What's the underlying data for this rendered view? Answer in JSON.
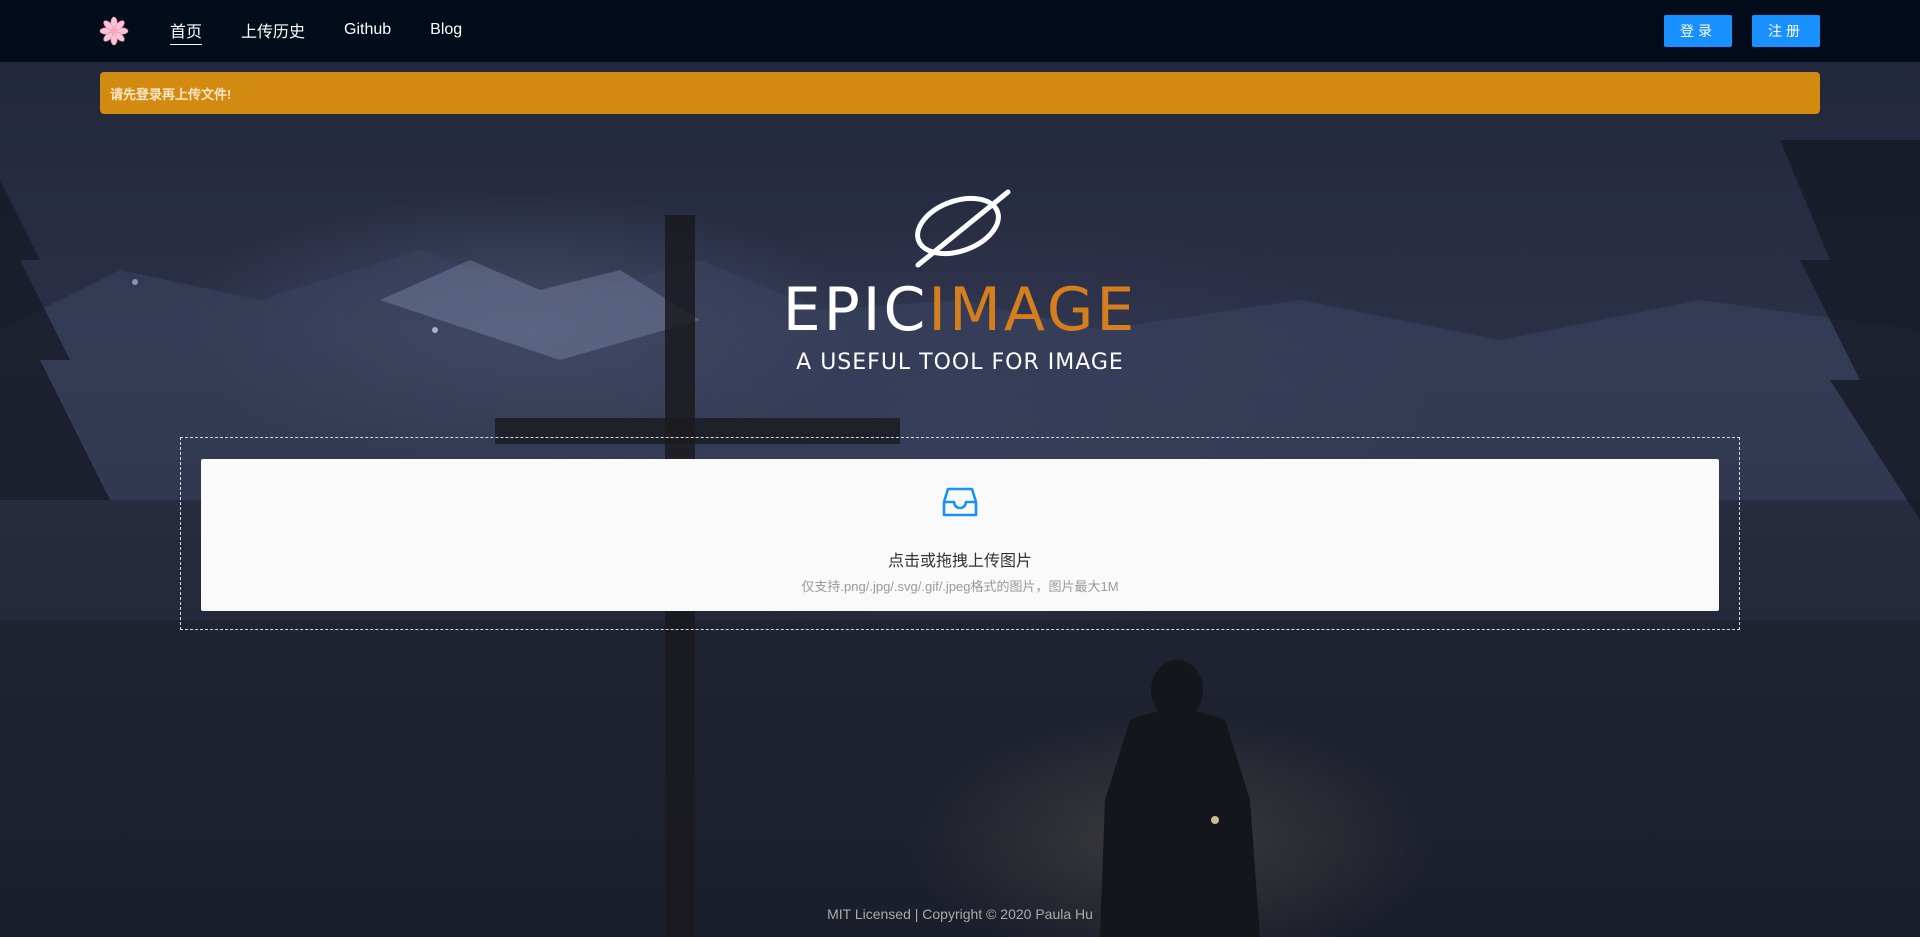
{
  "nav": {
    "logo_icon": "flower-icon",
    "links": [
      {
        "label": "首页",
        "active": true
      },
      {
        "label": "上传历史",
        "active": false
      },
      {
        "label": "Github",
        "active": false
      },
      {
        "label": "Blog",
        "active": false
      }
    ],
    "login_label": "登录",
    "register_label": "注册"
  },
  "alert": {
    "message": "请先登录再上传文件!",
    "color": "#d38a10"
  },
  "brand": {
    "title_part1": "EPIC",
    "title_part2": "IMAGE",
    "tagline": "A USEFUL TOOL FOR IMAGE",
    "accent_color": "#d57e1d"
  },
  "upload": {
    "icon": "inbox-icon",
    "title": "点击或拖拽上传图片",
    "hint": "仅支持.png/.jpg/.svg/.gif/.jpeg格式的图片，图片最大1M",
    "accent_color": "#1890ff"
  },
  "footer": {
    "text": "MIT Licensed | Copyright © 2020 Paula Hu"
  }
}
